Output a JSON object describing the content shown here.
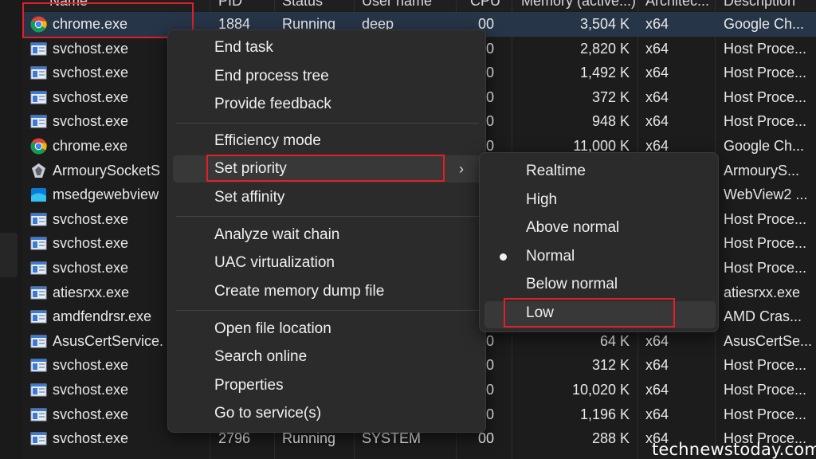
{
  "header": {
    "columns": [
      "Name",
      "PID",
      "Status",
      "User name",
      "CPU",
      "Memory (active...)",
      "Architec...",
      "Description"
    ]
  },
  "rows": [
    {
      "icon": "chrome-icon",
      "name": "chrome.exe",
      "pid": "1884",
      "status": "Running",
      "user": "deep",
      "cpu": "00",
      "memory": "3,504 K",
      "arch": "x64",
      "desc": "Google Ch..."
    },
    {
      "icon": "service-icon",
      "name": "svchost.exe",
      "pid": "",
      "status": "",
      "user": "",
      "cpu": "0",
      "memory": "2,820 K",
      "arch": "x64",
      "desc": "Host Proce..."
    },
    {
      "icon": "service-icon",
      "name": "svchost.exe",
      "pid": "",
      "status": "",
      "user": "",
      "cpu": "0",
      "memory": "1,492 K",
      "arch": "x64",
      "desc": "Host Proce..."
    },
    {
      "icon": "service-icon",
      "name": "svchost.exe",
      "pid": "",
      "status": "",
      "user": "",
      "cpu": "0",
      "memory": "372 K",
      "arch": "x64",
      "desc": "Host Proce..."
    },
    {
      "icon": "service-icon",
      "name": "svchost.exe",
      "pid": "",
      "status": "",
      "user": "",
      "cpu": "0",
      "memory": "948 K",
      "arch": "x64",
      "desc": "Host Proce..."
    },
    {
      "icon": "chrome-icon",
      "name": "chrome.exe",
      "pid": "",
      "status": "",
      "user": "",
      "cpu": "0",
      "memory": "11,000 K",
      "arch": "x64",
      "desc": "Google Ch..."
    },
    {
      "icon": "armoury-icon",
      "name": "ArmourySocketS",
      "pid": "",
      "status": "",
      "user": "",
      "cpu": "",
      "memory": "",
      "arch": "",
      "desc": "ArmouryS..."
    },
    {
      "icon": "webview-icon",
      "name": "msedgewebview",
      "pid": "",
      "status": "",
      "user": "",
      "cpu": "",
      "memory": "",
      "arch": "",
      "desc": "WebView2 ..."
    },
    {
      "icon": "service-icon",
      "name": "svchost.exe",
      "pid": "",
      "status": "",
      "user": "",
      "cpu": "",
      "memory": "",
      "arch": "",
      "desc": "Host Proce..."
    },
    {
      "icon": "service-icon",
      "name": "svchost.exe",
      "pid": "",
      "status": "",
      "user": "",
      "cpu": "",
      "memory": "",
      "arch": "",
      "desc": "Host Proce..."
    },
    {
      "icon": "service-icon",
      "name": "svchost.exe",
      "pid": "",
      "status": "",
      "user": "",
      "cpu": "",
      "memory": "",
      "arch": "",
      "desc": "Host Proce..."
    },
    {
      "icon": "service-icon",
      "name": "atiesrxx.exe",
      "pid": "",
      "status": "",
      "user": "",
      "cpu": "",
      "memory": "",
      "arch": "",
      "desc": "atiesrxx.exe"
    },
    {
      "icon": "service-icon",
      "name": "amdfendrsr.exe",
      "pid": "",
      "status": "",
      "user": "",
      "cpu": "",
      "memory": "",
      "arch": "",
      "desc": "AMD Cras..."
    },
    {
      "icon": "service-icon",
      "name": "AsusCertService.",
      "pid": "",
      "status": "",
      "user": "",
      "cpu": "0",
      "memory": "64 K",
      "arch": "x64",
      "desc": "AsusCertSe..."
    },
    {
      "icon": "service-icon",
      "name": "svchost.exe",
      "pid": "",
      "status": "",
      "user": "",
      "cpu": "0",
      "memory": "312 K",
      "arch": "x64",
      "desc": "Host Proce..."
    },
    {
      "icon": "service-icon",
      "name": "svchost.exe",
      "pid": "",
      "status": "",
      "user": "",
      "cpu": "0",
      "memory": "10,020 K",
      "arch": "x64",
      "desc": "Host Proce..."
    },
    {
      "icon": "service-icon",
      "name": "svchost.exe",
      "pid": "",
      "status": "",
      "user": "",
      "cpu": "0",
      "memory": "1,196 K",
      "arch": "x64",
      "desc": "Host Proce..."
    },
    {
      "icon": "service-icon",
      "name": "svchost.exe",
      "pid": "2796",
      "status": "Running",
      "user": "SYSTEM",
      "cpu": "00",
      "memory": "288 K",
      "arch": "x64",
      "desc": "Host Proce..."
    }
  ],
  "context_menu": {
    "end_task": "End task",
    "end_process_tree": "End process tree",
    "provide_feedback": "Provide feedback",
    "efficiency_mode": "Efficiency mode",
    "set_priority": "Set priority",
    "set_affinity": "Set affinity",
    "analyze_wait_chain": "Analyze wait chain",
    "uac_virtualization": "UAC virtualization",
    "create_memory_dump": "Create memory dump file",
    "open_file_location": "Open file location",
    "search_online": "Search online",
    "properties": "Properties",
    "go_to_services": "Go to service(s)",
    "submenu_arrow": "›"
  },
  "priority_submenu": {
    "realtime": "Realtime",
    "high": "High",
    "above_normal": "Above normal",
    "normal": "Normal",
    "below_normal": "Below normal",
    "low": "Low",
    "selected": "Normal"
  },
  "colors": {
    "highlight_box": "#e31e24",
    "selected_row": "#273548",
    "menu_bg": "#2b2b2b"
  },
  "watermark": "technewstoday.com"
}
